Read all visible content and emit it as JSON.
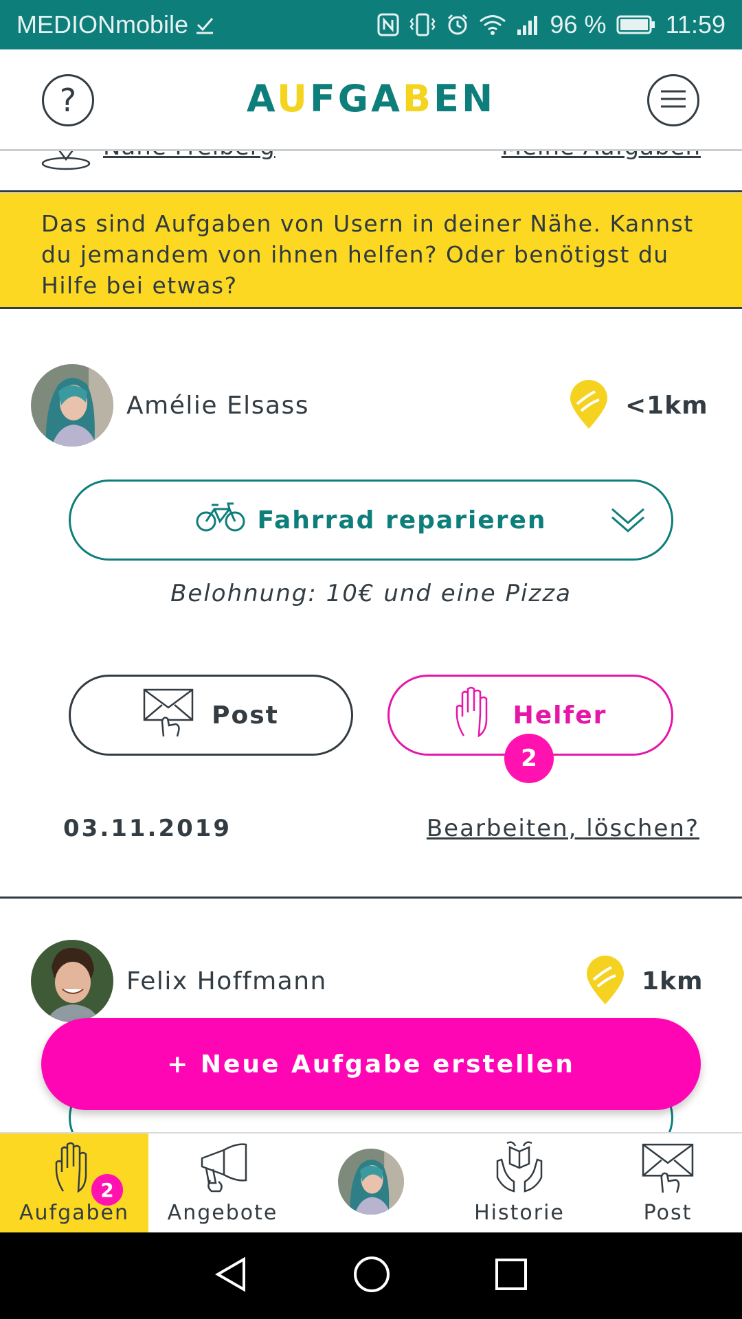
{
  "status_bar": {
    "carrier": "MEDIONmobile",
    "battery": "96 %",
    "time": "11:59",
    "color": "#0e7e7b"
  },
  "header": {
    "title_letters": [
      "A",
      "U",
      "F",
      "G",
      "A",
      "B",
      "E",
      "N"
    ],
    "title": "AUFGABEN",
    "help_symbol": "?"
  },
  "filter": {
    "location": "Nähe Freiberg",
    "my_tasks": "Meine Aufgaben"
  },
  "banner": {
    "text": "Das sind Aufgaben von Usern in deiner Nähe. Kannst du jemandem von ihnen helfen? Oder benötigst du Hilfe bei etwas?",
    "color": "#fcd823"
  },
  "tasks": [
    {
      "user": "Amélie Elsass",
      "distance": "<1km",
      "task": "Fahrrad reparieren",
      "reward": "Belohnung: 10€ und eine Pizza",
      "post_label": "Post",
      "helper_label": "Helfer",
      "helper_count": "2",
      "date": "03.11.2019",
      "edit_label": "Bearbeiten, löschen?"
    },
    {
      "user": "Felix Hoffmann",
      "distance": "1km"
    }
  ],
  "fab": {
    "label": "+ Neue Aufgabe erstellen",
    "color": "#ff06b4"
  },
  "bottom_nav": [
    {
      "label": "Aufgaben",
      "icon": "hand-icon",
      "badge": "2",
      "active": true
    },
    {
      "label": "Angebote",
      "icon": "megaphone-icon"
    },
    {
      "label": "",
      "icon": "profile-avatar"
    },
    {
      "label": "Historie",
      "icon": "book-hands-icon"
    },
    {
      "label": "Post",
      "icon": "envelope-icon"
    }
  ]
}
